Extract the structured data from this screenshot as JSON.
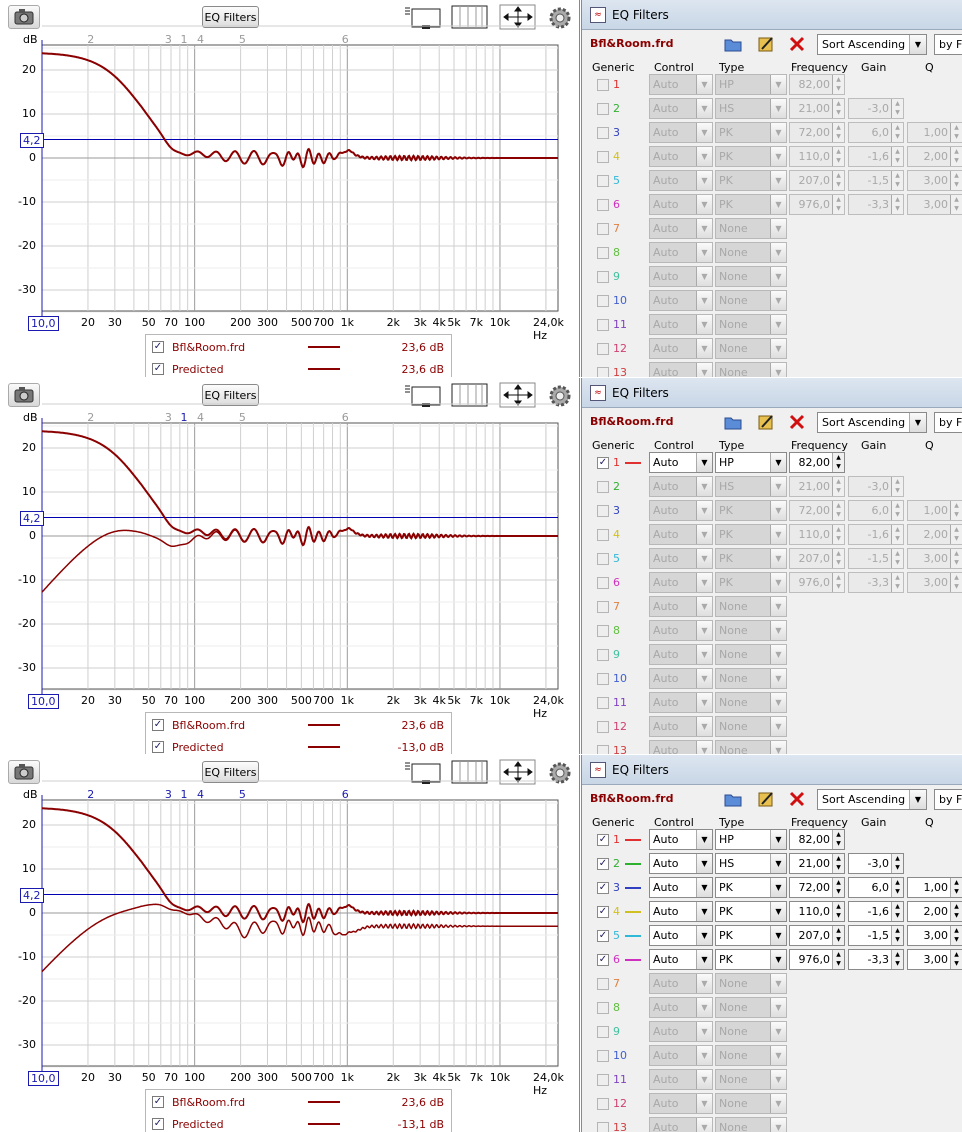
{
  "toolbar": {
    "eq_button_label": "EQ Filters"
  },
  "graph": {
    "y_axis_unit": "dB",
    "y_ticks": [
      "20",
      "10",
      "0",
      "-10",
      "-20",
      "-30"
    ],
    "x_ticks": [
      "20",
      "30",
      "50",
      "70",
      "100",
      "200",
      "300",
      "500",
      "700",
      "1k",
      "2k",
      "3k",
      "4k",
      "5k",
      "7k",
      "10k",
      "24,0k Hz"
    ],
    "x_min_box": "10,0",
    "target_level_box": "4,2",
    "filter_markers": [
      "2",
      "3",
      "1",
      "4",
      "5",
      "6"
    ],
    "target_level_db": 4.2,
    "curve_color": "#8b0000",
    "target_line_color": "#0000b0"
  },
  "eq_window": {
    "title": "EQ Filters",
    "file_name": "Bfl&Room.frd",
    "sort_value": "Sort Ascending",
    "by_value": "by Fr",
    "headers": {
      "generic": "Generic",
      "control": "Control",
      "type": "Type",
      "frequency": "Frequency",
      "gain": "Gain",
      "q": "Q"
    },
    "filters": [
      {
        "n": "1",
        "control": "Auto",
        "type": "HP",
        "freq": "82,00",
        "gain": "",
        "q": "",
        "color": "#e03030"
      },
      {
        "n": "2",
        "control": "Auto",
        "type": "HS",
        "freq": "21,00",
        "gain": "-3,0",
        "q": "",
        "color": "#30b030"
      },
      {
        "n": "3",
        "control": "Auto",
        "type": "PK",
        "freq": "72,00",
        "gain": "6,0",
        "q": "1,00",
        "color": "#3040c0"
      },
      {
        "n": "4",
        "control": "Auto",
        "type": "PK",
        "freq": "110,0",
        "gain": "-1,6",
        "q": "2,00",
        "color": "#d0c020"
      },
      {
        "n": "5",
        "control": "Auto",
        "type": "PK",
        "freq": "207,0",
        "gain": "-1,5",
        "q": "3,00",
        "color": "#30b8d8"
      },
      {
        "n": "6",
        "control": "Auto",
        "type": "PK",
        "freq": "976,0",
        "gain": "-3,3",
        "q": "3,00",
        "color": "#d030c0"
      },
      {
        "n": "7",
        "control": "Auto",
        "type": "None",
        "freq": "",
        "gain": "",
        "q": "",
        "color": "#e08040"
      },
      {
        "n": "8",
        "control": "Auto",
        "type": "None",
        "freq": "",
        "gain": "",
        "q": "",
        "color": "#60c040"
      },
      {
        "n": "9",
        "control": "Auto",
        "type": "None",
        "freq": "",
        "gain": "",
        "q": "",
        "color": "#40c0a0"
      },
      {
        "n": "10",
        "control": "Auto",
        "type": "None",
        "freq": "",
        "gain": "",
        "q": "",
        "color": "#4060d0"
      },
      {
        "n": "11",
        "control": "Auto",
        "type": "None",
        "freq": "",
        "gain": "",
        "q": "",
        "color": "#8040c0"
      },
      {
        "n": "12",
        "control": "Auto",
        "type": "None",
        "freq": "",
        "gain": "",
        "q": "",
        "color": "#d04070"
      },
      {
        "n": "13",
        "control": "Auto",
        "type": "None",
        "freq": "",
        "gain": "",
        "q": "",
        "color": "#d04040"
      }
    ]
  },
  "panels": [
    {
      "enabled_count": 0,
      "markers_active": false,
      "predicted_mode": "same",
      "legend": [
        {
          "name": "Bfl&Room.frd",
          "value": "23,6 dB",
          "checked": true
        },
        {
          "name": "Predicted",
          "value": "23,6 dB",
          "checked": true
        }
      ]
    },
    {
      "enabled_count": 1,
      "markers_active": false,
      "predicted_mode": "hp",
      "legend": [
        {
          "name": "Bfl&Room.frd",
          "value": "23,6 dB",
          "checked": true
        },
        {
          "name": "Predicted",
          "value": "-13,0 dB",
          "checked": true
        }
      ]
    },
    {
      "enabled_count": 6,
      "markers_active": true,
      "predicted_mode": "full",
      "legend": [
        {
          "name": "Bfl&Room.frd",
          "value": "23,6 dB",
          "checked": true
        },
        {
          "name": "Predicted",
          "value": "-13,1 dB",
          "checked": true
        }
      ]
    }
  ]
}
